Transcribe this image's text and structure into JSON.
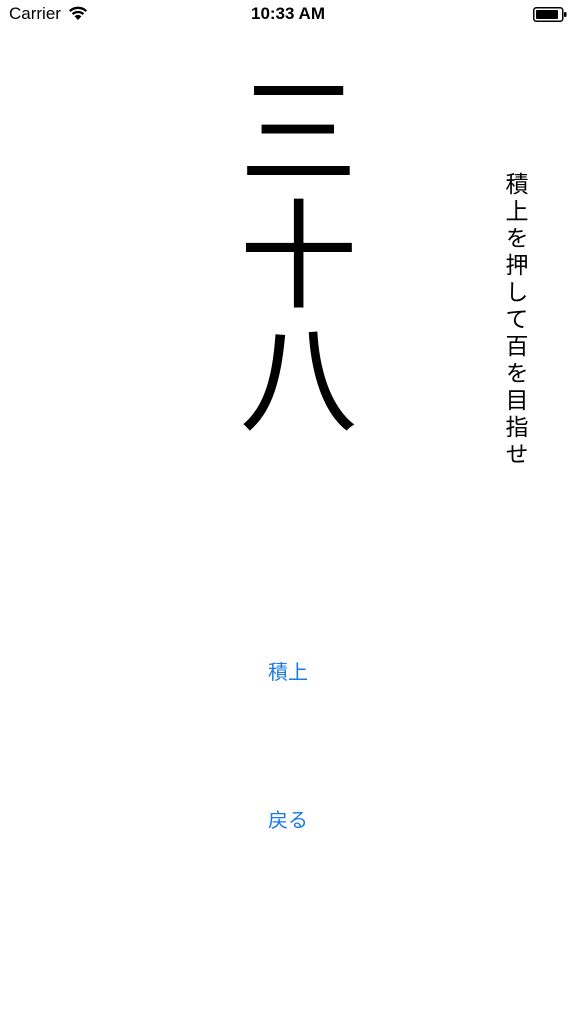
{
  "status_bar": {
    "carrier": "Carrier",
    "time": "10:33 AM",
    "wifi_icon": "wifi-icon",
    "battery_icon": "battery-icon"
  },
  "main": {
    "count_text": "三十八",
    "hint_text": "積上を押して百を目指せ"
  },
  "buttons": {
    "add_label": "積上",
    "back_label": "戻る"
  },
  "colors": {
    "accent": "#1a7ae8",
    "text": "#000000",
    "background": "#ffffff"
  }
}
